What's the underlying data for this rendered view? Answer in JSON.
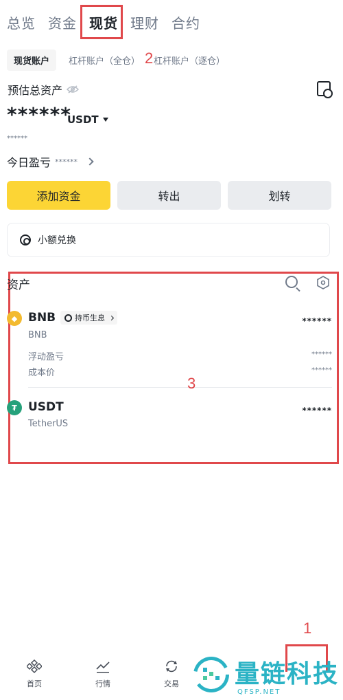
{
  "top_tabs": [
    "总览",
    "资金",
    "现货",
    "理财",
    "合约"
  ],
  "sub_tabs": [
    "现货账户",
    "杠杆账户（全仓）",
    "杠杆账户（逐仓）"
  ],
  "annotations": [
    "1",
    "2",
    "3"
  ],
  "summary": {
    "est_label": "预估总资产",
    "balance": "******",
    "currency": "USDT",
    "balance_sub": "******",
    "pnl_label": "今日盈亏",
    "pnl_value": "******"
  },
  "actions": {
    "add": "添加资金",
    "withdraw": "转出",
    "transfer": "划转"
  },
  "convert_label": "小额兑换",
  "assets": {
    "title": "资产",
    "items": [
      {
        "symbol": "BNB",
        "name": "BNB",
        "amount": "******",
        "badge": "持币生息",
        "details": [
          {
            "label": "浮动盈亏",
            "value": "******"
          },
          {
            "label": "成本价",
            "value": "******"
          }
        ]
      },
      {
        "symbol": "USDT",
        "name": "TetherUS",
        "amount": "******"
      }
    ]
  },
  "bottom_nav": [
    "首页",
    "行情",
    "交易"
  ],
  "watermark": {
    "text": "量链科技",
    "sub": "QFSP.NET"
  },
  "colors": {
    "brand_yellow": "#fcd535",
    "annotation_red": "#e0484b",
    "watermark": "#2bb3c5"
  }
}
